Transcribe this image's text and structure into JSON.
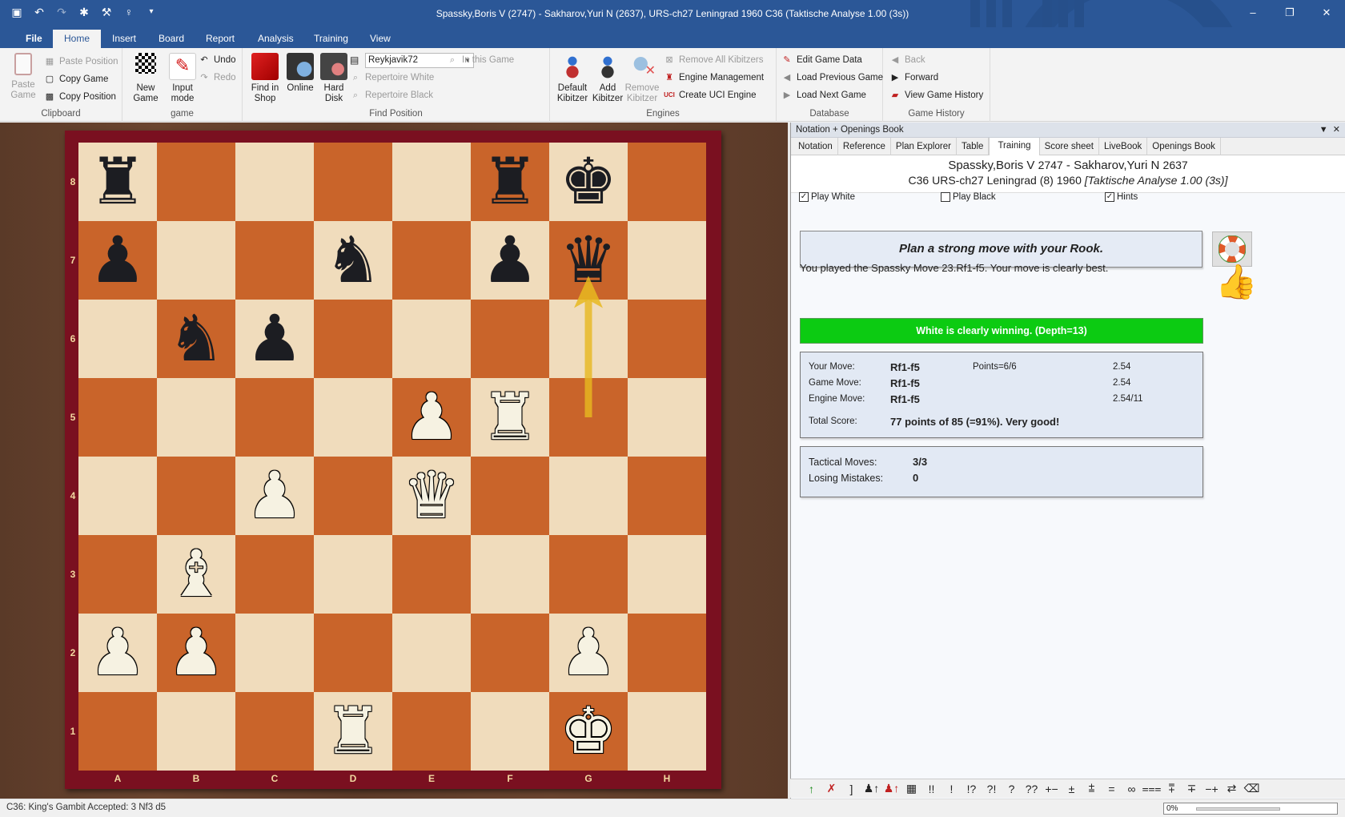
{
  "window": {
    "title": "Spassky,Boris V (2747) - Sakharov,Yuri N (2637), URS-ch27 Leningrad 1960  C36  (Taktische Analyse 1.00 (3s))",
    "quick_access": [
      "save-icon",
      "undo-icon",
      "redo-icon",
      "engine-icon",
      "tools-icon",
      "hint-bulb-icon",
      "customize-icon"
    ],
    "controls": {
      "minimize": "‒",
      "restore": "❐",
      "close": "✕"
    }
  },
  "ribbon_tabs": [
    {
      "label": "File",
      "active": false
    },
    {
      "label": "Home",
      "active": true
    },
    {
      "label": "Insert",
      "active": false
    },
    {
      "label": "Board",
      "active": false
    },
    {
      "label": "Report",
      "active": false
    },
    {
      "label": "Analysis",
      "active": false
    },
    {
      "label": "Training",
      "active": false
    },
    {
      "label": "View",
      "active": false
    }
  ],
  "ribbon": {
    "clipboard": {
      "label": "Clipboard",
      "paste_game": "Paste Game",
      "paste_position": "Paste Position",
      "copy_game": "Copy Game",
      "copy_position": "Copy Position"
    },
    "game": {
      "label": "game",
      "new_game": "New Game",
      "input_mode": "Input mode",
      "undo": "Undo",
      "redo": "Redo"
    },
    "find_position": {
      "label": "Find Position",
      "find_in_shop": "Find in Shop",
      "online": "Online",
      "hard_disk": "Hard Disk",
      "combo_value": "Reykjavik72",
      "in_this_game": "In this Game",
      "repertoire_white": "Repertoire White",
      "repertoire_black": "Repertoire Black"
    },
    "engines": {
      "label": "Engines",
      "default_kibitzer": "Default Kibitzer",
      "add_kibitzer": "Add Kibitzer",
      "remove_kibitzer": "Remove Kibitzer",
      "remove_all_kibitzers": "Remove All Kibitzers",
      "engine_management": "Engine Management",
      "create_uci_engine": "Create UCI Engine"
    },
    "database": {
      "label": "Database",
      "edit_game_data": "Edit Game Data",
      "load_previous_game": "Load Previous Game",
      "load_next_game": "Load Next Game"
    },
    "game_history": {
      "label": "Game History",
      "back": "Back",
      "forward": "Forward",
      "view_game_history": "View Game History"
    }
  },
  "board": {
    "ranks": [
      "8",
      "7",
      "6",
      "5",
      "4",
      "3",
      "2",
      "1"
    ],
    "files": [
      "A",
      "B",
      "C",
      "D",
      "E",
      "F",
      "G",
      "H"
    ],
    "pieces": [
      {
        "sq": "a8",
        "color": "b",
        "type": "rook"
      },
      {
        "sq": "f8",
        "color": "b",
        "type": "rook"
      },
      {
        "sq": "g8",
        "color": "b",
        "type": "king"
      },
      {
        "sq": "a7",
        "color": "b",
        "type": "pawn"
      },
      {
        "sq": "d7",
        "color": "b",
        "type": "knight"
      },
      {
        "sq": "f7",
        "color": "b",
        "type": "pawn"
      },
      {
        "sq": "g7",
        "color": "b",
        "type": "queen"
      },
      {
        "sq": "b6",
        "color": "b",
        "type": "knight"
      },
      {
        "sq": "c6",
        "color": "b",
        "type": "pawn"
      },
      {
        "sq": "e5",
        "color": "w",
        "type": "pawn"
      },
      {
        "sq": "f5",
        "color": "w",
        "type": "rook"
      },
      {
        "sq": "c4",
        "color": "w",
        "type": "pawn"
      },
      {
        "sq": "e4",
        "color": "w",
        "type": "queen"
      },
      {
        "sq": "b3",
        "color": "w",
        "type": "bishop"
      },
      {
        "sq": "a2",
        "color": "w",
        "type": "pawn"
      },
      {
        "sq": "b2",
        "color": "w",
        "type": "pawn"
      },
      {
        "sq": "g2",
        "color": "w",
        "type": "pawn"
      },
      {
        "sq": "d1",
        "color": "w",
        "type": "rook"
      },
      {
        "sq": "g1",
        "color": "w",
        "type": "king"
      }
    ],
    "hint_arrow": {
      "from": "g5",
      "to": "g7",
      "color": "#e8b820"
    }
  },
  "panel": {
    "title": "Notation + Openings Book",
    "tabs": [
      {
        "label": "Notation",
        "active": false
      },
      {
        "label": "Reference",
        "active": false
      },
      {
        "label": "Plan Explorer",
        "active": false
      },
      {
        "label": "Table",
        "active": false
      },
      {
        "label": "Training",
        "active": true
      },
      {
        "label": "Score sheet",
        "active": false
      },
      {
        "label": "LiveBook",
        "active": false
      },
      {
        "label": "Openings Book",
        "active": false
      }
    ],
    "header": {
      "white": "Spassky,Boris V",
      "white_elo": "2747",
      "sep": " - ",
      "black": "Sakharov,Yuri N",
      "black_elo": "2637",
      "eco": "C36",
      "event": "URS-ch27 Leningrad (8) 1960",
      "annotator": "[Taktische Analyse 1.00 (3s)]"
    },
    "training": {
      "play_white": {
        "label": "Play White",
        "checked": true
      },
      "play_black": {
        "label": "Play Black",
        "checked": false
      },
      "hints": {
        "label": "Hints",
        "checked": true
      },
      "plan_text": "Plan a strong move with your Rook.",
      "feedback": "You played the Spassky Move  23.Rf1-f5. Your move is clearly best.",
      "eval_text": "White is clearly winning. (Depth=13)",
      "eval_color": "#0ccb12",
      "your_move_label": "Your Move:",
      "your_move": "Rf1-f5",
      "points": "Points=6/6",
      "your_move_eval": "2.54",
      "game_move_label": "Game Move:",
      "game_move": "Rf1-f5",
      "game_move_eval": "2.54",
      "engine_move_label": "Engine Move:",
      "engine_move": "Rf1-f5",
      "engine_move_eval": "2.54/11",
      "total_score_label": "Total Score:",
      "total_score": "77 points of 85 (=91%). Very good!",
      "tactical_moves_label": "Tactical Moves:",
      "tactical_moves": "3/3",
      "losing_mistakes_label": "Losing Mistakes:",
      "losing_mistakes": "0"
    },
    "annotation_toolbar": [
      "↑",
      "✗",
      "]",
      "♟↑",
      "♟↑",
      "▦",
      "!!",
      "!",
      "!?",
      "?!",
      "?",
      "??",
      "+−",
      "±",
      "⩲",
      "=",
      "∞",
      "⩶",
      "⩱",
      "∓",
      "−+",
      "⇄",
      "⌫"
    ]
  },
  "status": {
    "text": "C36: King's Gambit Accepted: 3 Nf3 d5",
    "progress": "0%"
  }
}
